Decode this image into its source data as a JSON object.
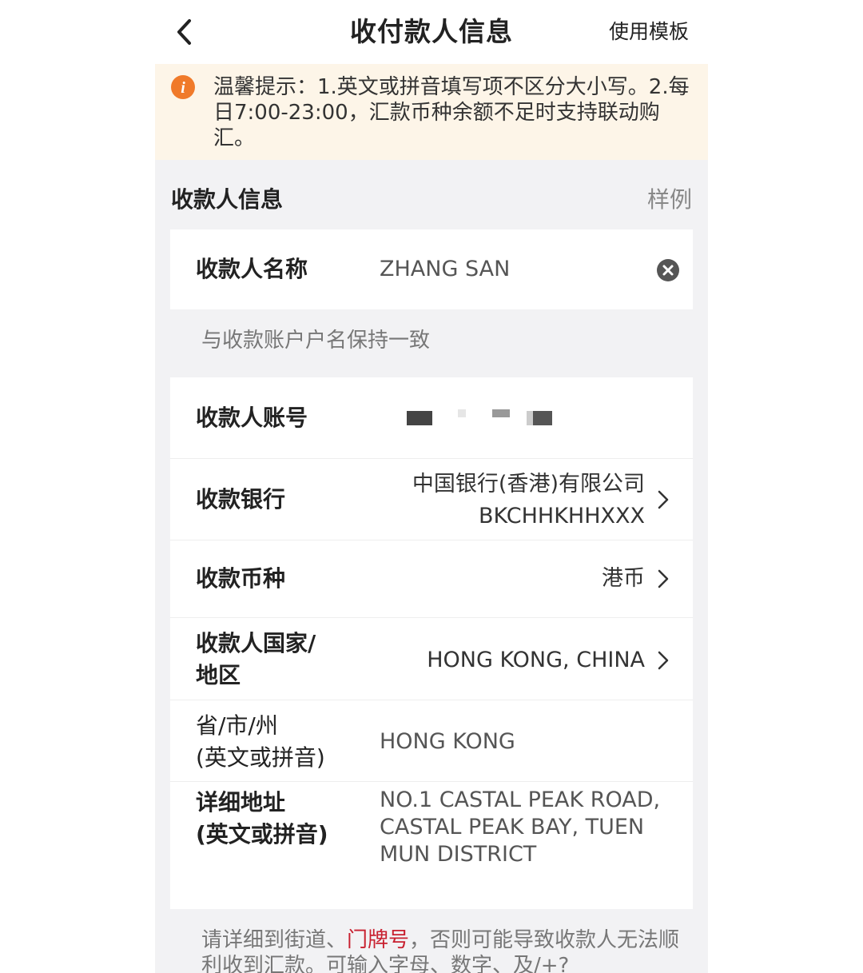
{
  "nav": {
    "title": "收付款人信息",
    "action_label": "使用模板"
  },
  "notice": {
    "text": "温馨提示：1.英文或拼音填写项不区分大小写。2.每日7:00-23:00，汇款币种余额不足时支持联动购汇。"
  },
  "section": {
    "title": "收款人信息",
    "example_link": "样例"
  },
  "payee": {
    "name_label": "收款人名称",
    "name_value": "ZHANG SAN",
    "name_hint": "与收款账户户名保持一致"
  },
  "fields": {
    "account_label": "收款人账号",
    "bank_label": "收款银行",
    "bank_name": "中国银行(香港)有限公司",
    "bank_swift": "BKCHHKHHXXX",
    "currency_label": "收款币种",
    "currency_value": "港币",
    "country_label_1": "收款人国家/",
    "country_label_2": "地区",
    "country_value": "HONG KONG, CHINA",
    "province_label_1": "省/市/州",
    "province_label_2": "(英文或拼音)",
    "province_value": "HONG KONG",
    "address_label_1": "详细地址",
    "address_label_2": "(英文或拼音)",
    "address_line_1": "NO.1 CASTAL PEAK ROAD,",
    "address_line_2": "CASTAL PEAK BAY, TUEN",
    "address_line_3": "MUN DISTRICT"
  },
  "footer": {
    "hint_part1": "请详细到街道、",
    "hint_highlight": "门牌号",
    "hint_part2": "，否则可能导致收款人无法顺利收到汇款。可输入字母、数字、及/+?"
  },
  "colors": {
    "accent_orange": "#f07a2a",
    "highlight_red": "#c8202f",
    "notice_bg": "#fdf5e8",
    "page_bg": "#f2f2f4"
  }
}
